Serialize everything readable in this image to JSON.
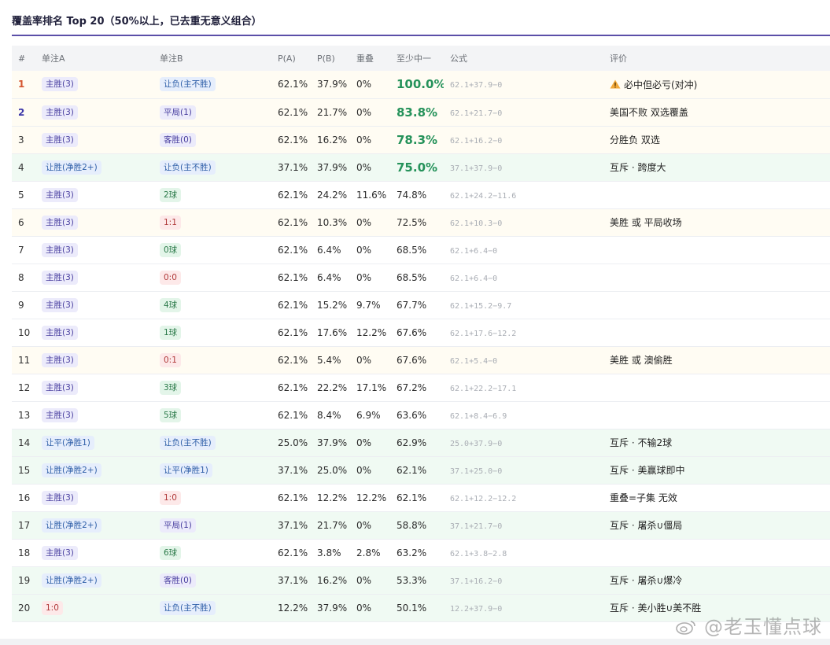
{
  "title": "覆盖率排名 Top 20（50%以上，已去重无意义组合）",
  "headers": [
    "#",
    "单注A",
    "单注B",
    "P(A)",
    "P(B)",
    "重叠",
    "至少中一",
    "公式",
    "评价"
  ],
  "rows": [
    {
      "rank": "1",
      "a": "主胜(3)",
      "a_color": "purple",
      "b": "让负(主不胜)",
      "b_color": "blue",
      "pa": "62.1%",
      "pb": "37.9%",
      "overlap": "0%",
      "cover": "100.0%",
      "cover_big": true,
      "formula": "62.1+37.9−0",
      "comment": "必中但必亏(对冲)",
      "warn": true,
      "style": "top"
    },
    {
      "rank": "2",
      "a": "主胜(3)",
      "a_color": "purple",
      "b": "平局(1)",
      "b_color": "purple",
      "pa": "62.1%",
      "pb": "21.7%",
      "overlap": "0%",
      "cover": "83.8%",
      "cover_big": true,
      "formula": "62.1+21.7−0",
      "comment": "美国不败 双选覆盖",
      "style": "top"
    },
    {
      "rank": "3",
      "a": "主胜(3)",
      "a_color": "purple",
      "b": "客胜(0)",
      "b_color": "purple",
      "pa": "62.1%",
      "pb": "16.2%",
      "overlap": "0%",
      "cover": "78.3%",
      "cover_big": true,
      "formula": "62.1+16.2−0",
      "comment": "分胜负 双选",
      "style": "top"
    },
    {
      "rank": "4",
      "a": "让胜(净胜2+)",
      "a_color": "blue",
      "b": "让负(主不胜)",
      "b_color": "blue",
      "pa": "37.1%",
      "pb": "37.9%",
      "overlap": "0%",
      "cover": "75.0%",
      "cover_big": true,
      "formula": "37.1+37.9−0",
      "comment": "互斥 · 跨度大",
      "style": "excl"
    },
    {
      "rank": "5",
      "a": "主胜(3)",
      "a_color": "purple",
      "b": "2球",
      "b_color": "green",
      "pa": "62.1%",
      "pb": "24.2%",
      "overlap": "11.6%",
      "cover": "74.8%",
      "formula": "62.1+24.2−11.6",
      "comment": "",
      "style": "plain"
    },
    {
      "rank": "6",
      "a": "主胜(3)",
      "a_color": "purple",
      "b": "1:1",
      "b_color": "red",
      "pa": "62.1%",
      "pb": "10.3%",
      "overlap": "0%",
      "cover": "72.5%",
      "formula": "62.1+10.3−0",
      "comment": "美胜 或 平局收场",
      "style": "top"
    },
    {
      "rank": "7",
      "a": "主胜(3)",
      "a_color": "purple",
      "b": "0球",
      "b_color": "green",
      "pa": "62.1%",
      "pb": "6.4%",
      "overlap": "0%",
      "cover": "68.5%",
      "formula": "62.1+6.4−0",
      "comment": "",
      "style": "plain"
    },
    {
      "rank": "8",
      "a": "主胜(3)",
      "a_color": "purple",
      "b": "0:0",
      "b_color": "red",
      "pa": "62.1%",
      "pb": "6.4%",
      "overlap": "0%",
      "cover": "68.5%",
      "formula": "62.1+6.4−0",
      "comment": "",
      "style": "plain"
    },
    {
      "rank": "9",
      "a": "主胜(3)",
      "a_color": "purple",
      "b": "4球",
      "b_color": "green",
      "pa": "62.1%",
      "pb": "15.2%",
      "overlap": "9.7%",
      "cover": "67.7%",
      "formula": "62.1+15.2−9.7",
      "comment": "",
      "style": "plain"
    },
    {
      "rank": "10",
      "a": "主胜(3)",
      "a_color": "purple",
      "b": "1球",
      "b_color": "green",
      "pa": "62.1%",
      "pb": "17.6%",
      "overlap": "12.2%",
      "cover": "67.6%",
      "formula": "62.1+17.6−12.2",
      "comment": "",
      "style": "plain"
    },
    {
      "rank": "11",
      "a": "主胜(3)",
      "a_color": "purple",
      "b": "0:1",
      "b_color": "red",
      "pa": "62.1%",
      "pb": "5.4%",
      "overlap": "0%",
      "cover": "67.6%",
      "formula": "62.1+5.4−0",
      "comment": "美胜 或 澳偷胜",
      "style": "top"
    },
    {
      "rank": "12",
      "a": "主胜(3)",
      "a_color": "purple",
      "b": "3球",
      "b_color": "green",
      "pa": "62.1%",
      "pb": "22.2%",
      "overlap": "17.1%",
      "cover": "67.2%",
      "formula": "62.1+22.2−17.1",
      "comment": "",
      "style": "plain"
    },
    {
      "rank": "13",
      "a": "主胜(3)",
      "a_color": "purple",
      "b": "5球",
      "b_color": "green",
      "pa": "62.1%",
      "pb": "8.4%",
      "overlap": "6.9%",
      "cover": "63.6%",
      "formula": "62.1+8.4−6.9",
      "comment": "",
      "style": "plain"
    },
    {
      "rank": "14",
      "a": "让平(净胜1)",
      "a_color": "blue",
      "b": "让负(主不胜)",
      "b_color": "blue",
      "pa": "25.0%",
      "pb": "37.9%",
      "overlap": "0%",
      "cover": "62.9%",
      "formula": "25.0+37.9−0",
      "comment": "互斥 · 不输2球",
      "style": "excl"
    },
    {
      "rank": "15",
      "a": "让胜(净胜2+)",
      "a_color": "blue",
      "b": "让平(净胜1)",
      "b_color": "blue",
      "pa": "37.1%",
      "pb": "25.0%",
      "overlap": "0%",
      "cover": "62.1%",
      "formula": "37.1+25.0−0",
      "comment": "互斥 · 美赢球即中",
      "style": "excl"
    },
    {
      "rank": "16",
      "a": "主胜(3)",
      "a_color": "purple",
      "b": "1:0",
      "b_color": "red",
      "pa": "62.1%",
      "pb": "12.2%",
      "overlap": "12.2%",
      "cover": "62.1%",
      "formula": "62.1+12.2−12.2",
      "comment": "重叠=子集 无效",
      "style": "plain"
    },
    {
      "rank": "17",
      "a": "让胜(净胜2+)",
      "a_color": "blue",
      "b": "平局(1)",
      "b_color": "purple",
      "pa": "37.1%",
      "pb": "21.7%",
      "overlap": "0%",
      "cover": "58.8%",
      "formula": "37.1+21.7−0",
      "comment": "互斥 · 屠杀∪僵局",
      "style": "excl"
    },
    {
      "rank": "18",
      "a": "主胜(3)",
      "a_color": "purple",
      "b": "6球",
      "b_color": "green",
      "pa": "62.1%",
      "pb": "3.8%",
      "overlap": "2.8%",
      "cover": "63.2%",
      "formula": "62.1+3.8−2.8",
      "comment": "",
      "style": "plain"
    },
    {
      "rank": "19",
      "a": "让胜(净胜2+)",
      "a_color": "blue",
      "b": "客胜(0)",
      "b_color": "purple",
      "pa": "37.1%",
      "pb": "16.2%",
      "overlap": "0%",
      "cover": "53.3%",
      "formula": "37.1+16.2−0",
      "comment": "互斥 · 屠杀∪爆冷",
      "style": "excl"
    },
    {
      "rank": "20",
      "a": "1:0",
      "a_color": "red",
      "b": "让负(主不胜)",
      "b_color": "blue",
      "pa": "12.2%",
      "pb": "37.9%",
      "overlap": "0%",
      "cover": "50.1%",
      "formula": "12.2+37.9−0",
      "comment": "互斥 · 美小胜∪美不胜",
      "style": "excl"
    }
  ],
  "watermark": "@老玉懂点球",
  "icons": {
    "warning": "warning-triangle-icon",
    "watermark_logo": "weibo-logo-icon"
  },
  "colors": {
    "accent": "#5b4fa8",
    "cover_green": "#25925a",
    "rank1": "#d4542e",
    "rank2": "#3b36a8"
  }
}
